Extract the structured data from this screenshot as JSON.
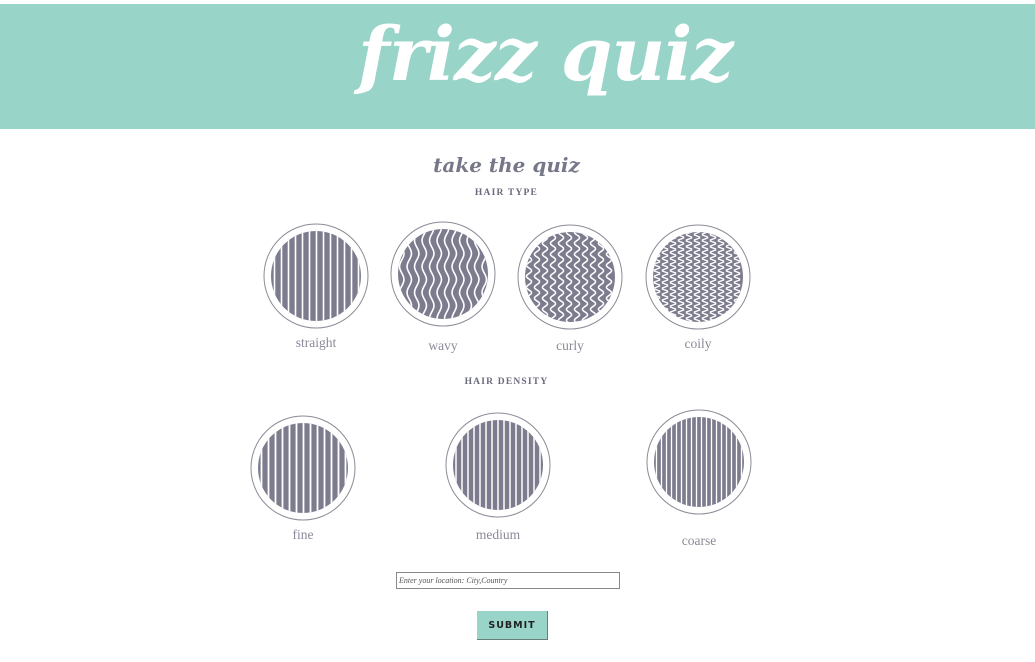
{
  "header": {
    "title": "frizz quiz",
    "bg_color": "#98d4c8"
  },
  "quiz": {
    "heading": "take the quiz"
  },
  "hair_type": {
    "label": "HAIR TYPE",
    "options": [
      {
        "label": "straight",
        "pattern": "straight"
      },
      {
        "label": "wavy",
        "pattern": "wavy"
      },
      {
        "label": "curly",
        "pattern": "curly"
      },
      {
        "label": "coily",
        "pattern": "coily"
      }
    ]
  },
  "hair_density": {
    "label": "HAIR DENSITY",
    "options": [
      {
        "label": "fine",
        "pattern": "fine"
      },
      {
        "label": "medium",
        "pattern": "medium"
      },
      {
        "label": "coarse",
        "pattern": "coarse"
      }
    ]
  },
  "location": {
    "placeholder": "Enter your location: City,Country",
    "value": ""
  },
  "submit": {
    "label": "SUBMIT",
    "bg_color": "#98d4c8"
  },
  "colors": {
    "swatch_fill": "#7d7c8e",
    "line_color": "#ffffff"
  }
}
